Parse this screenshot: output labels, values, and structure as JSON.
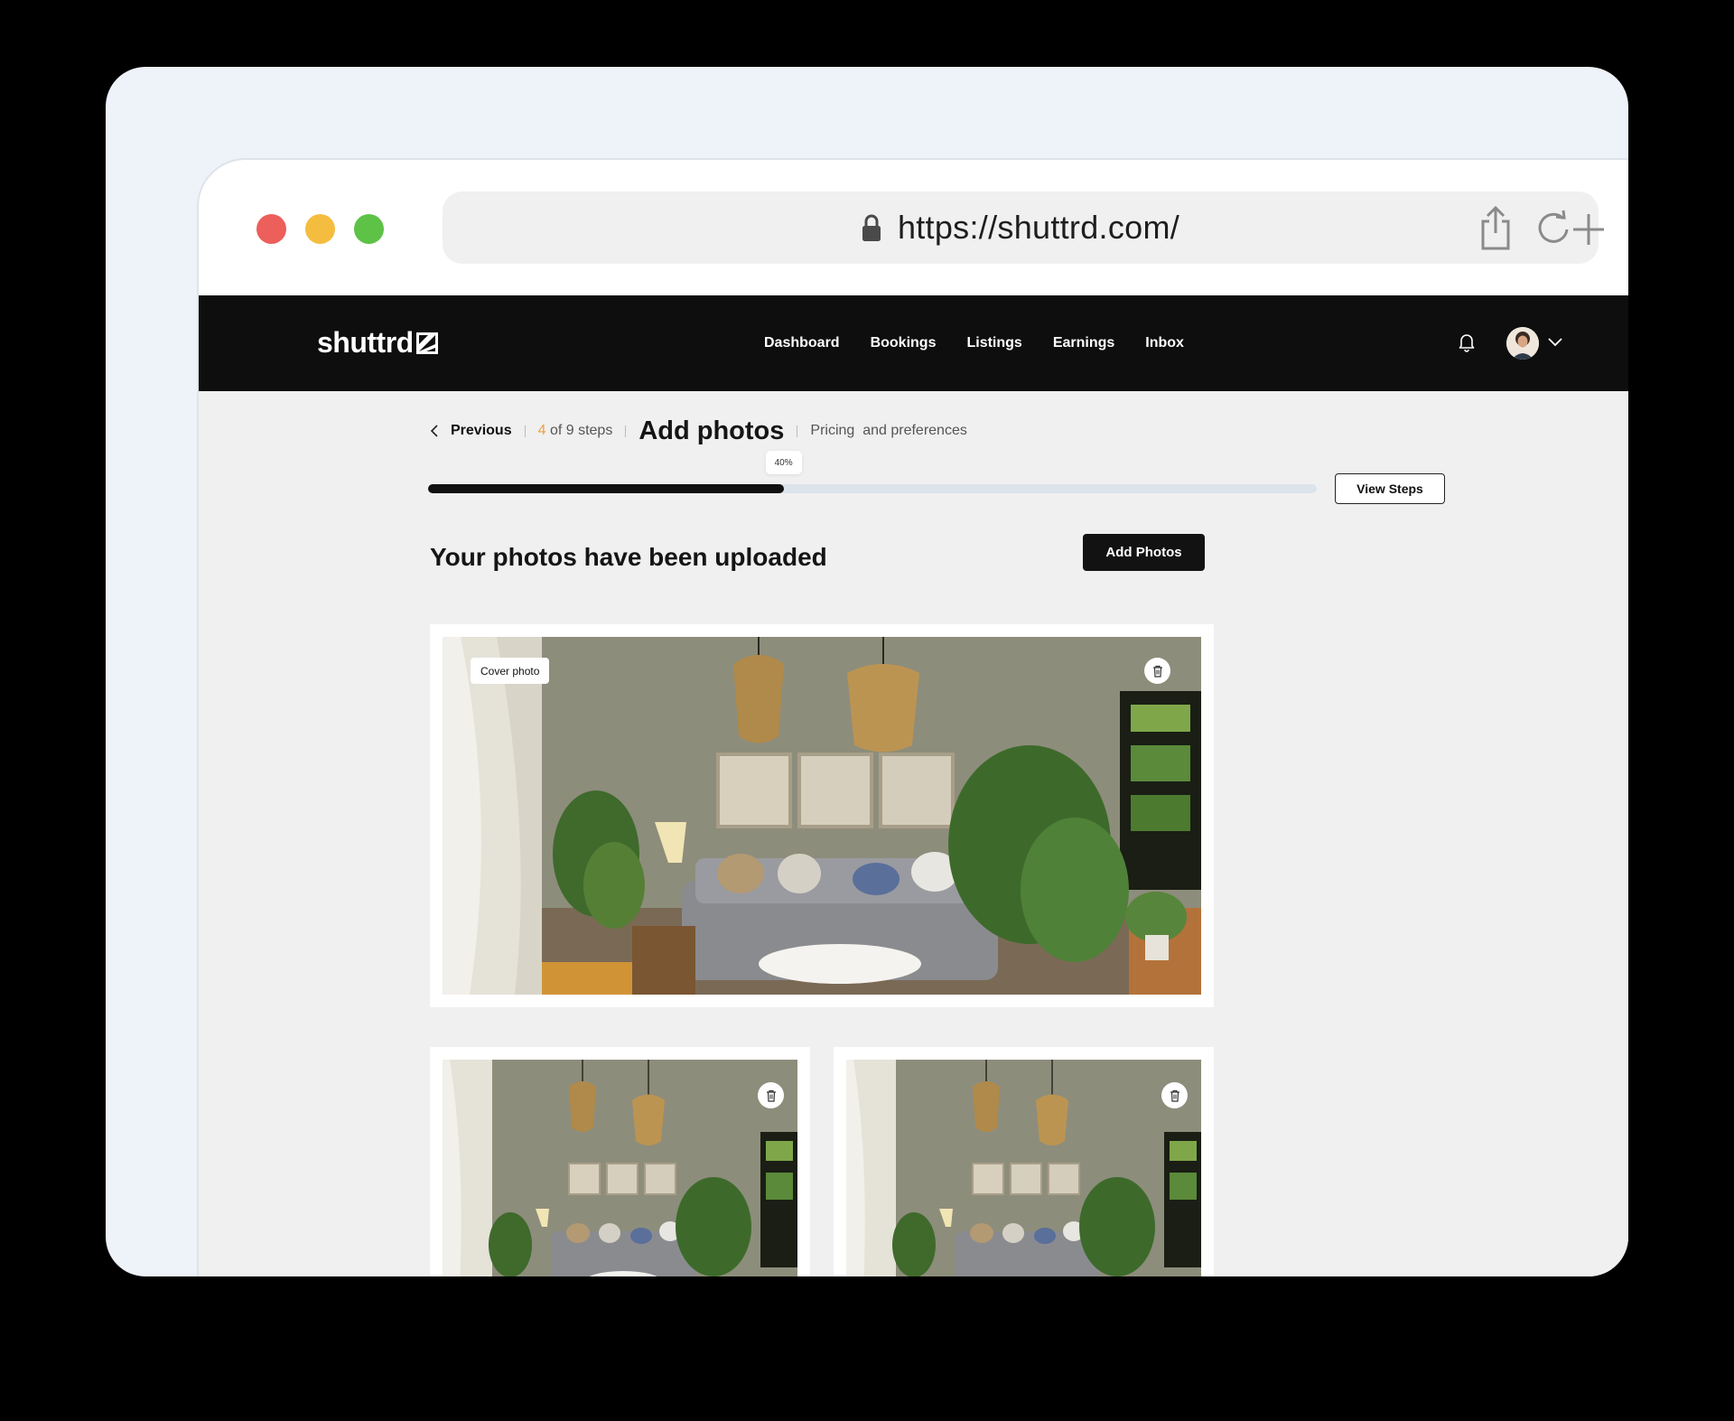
{
  "window": {
    "url": "https://shuttrd.com/",
    "traffic_lights": [
      "#ec5f5a",
      "#f5bd3f",
      "#5dc245"
    ]
  },
  "nav": {
    "logo": "shuttrd",
    "links": [
      "Dashboard",
      "Bookings",
      "Listings",
      "Earnings",
      "Inbox"
    ]
  },
  "steps": {
    "previous_label": "Previous",
    "step_current": "4",
    "step_total_text": " of 9 steps",
    "title": "Add photos",
    "next_step": "Pricing  and preferences",
    "progress_percent": 40,
    "progress_label": "40%",
    "view_steps_label": "View Steps"
  },
  "photos": {
    "heading": "Your photos have been uploaded",
    "add_button": "Add Photos",
    "cover_label": "Cover photo",
    "items": [
      "cover",
      "photo-2",
      "photo-3"
    ]
  },
  "colors": {
    "accent_orange": "#e9a23b",
    "dark": "#121212"
  }
}
